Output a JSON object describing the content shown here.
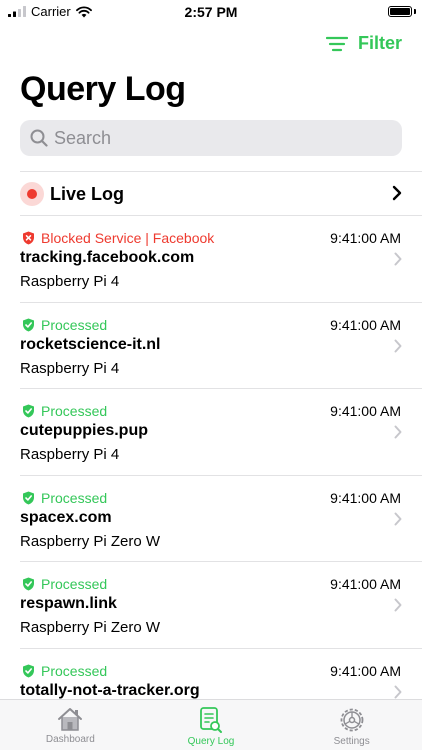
{
  "status_bar": {
    "carrier": "Carrier",
    "time": "2:57 PM"
  },
  "header": {
    "filter_label": "Filter",
    "title": "Query Log"
  },
  "search": {
    "placeholder": "Search"
  },
  "live_log": {
    "label": "Live Log"
  },
  "entries": [
    {
      "status": "Blocked Service | Facebook",
      "state": "blocked",
      "time": "9:41:00 AM",
      "domain": "tracking.facebook.com",
      "client": "Raspberry Pi 4"
    },
    {
      "status": "Processed",
      "state": "processed",
      "time": "9:41:00 AM",
      "domain": "rocketscience-it.nl",
      "client": "Raspberry Pi 4"
    },
    {
      "status": "Processed",
      "state": "processed",
      "time": "9:41:00 AM",
      "domain": "cutepuppies.pup",
      "client": "Raspberry Pi 4"
    },
    {
      "status": "Processed",
      "state": "processed",
      "time": "9:41:00 AM",
      "domain": "spacex.com",
      "client": "Raspberry Pi Zero W"
    },
    {
      "status": "Processed",
      "state": "processed",
      "time": "9:41:00 AM",
      "domain": "respawn.link",
      "client": "Raspberry Pi Zero W"
    },
    {
      "status": "Processed",
      "state": "processed",
      "time": "9:41:00 AM",
      "domain": "totally-not-a-tracker.org",
      "client": ""
    }
  ],
  "tabs": [
    {
      "label": "Dashboard",
      "icon": "house-icon",
      "active": false
    },
    {
      "label": "Query Log",
      "icon": "document-search-icon",
      "active": true
    },
    {
      "label": "Settings",
      "icon": "gear-icon",
      "active": false
    }
  ],
  "colors": {
    "accent": "#34c759",
    "blocked": "#ee3a2f",
    "inactive": "#8e8e93"
  }
}
